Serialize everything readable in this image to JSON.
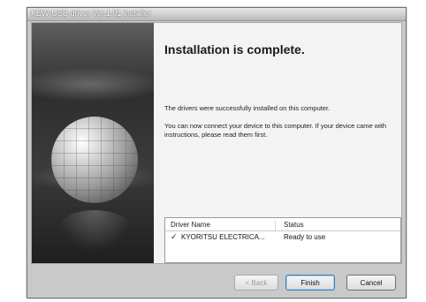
{
  "window": {
    "title": "KEW-USB driver Ver.1.01 installer"
  },
  "main": {
    "heading": "Installation is complete.",
    "message_success": "The drivers were successfully installed on this computer.",
    "message_connect": "You can now connect your device to this computer. If your device came with instructions, please read them first."
  },
  "driver_table": {
    "columns": [
      "Driver Name",
      "Status"
    ],
    "rows": [
      {
        "check": "✓",
        "name": "KYORITSU ELECTRICA...",
        "status": "Ready to use"
      }
    ]
  },
  "buttons": {
    "back": "< Back",
    "finish": "Finish",
    "cancel": "Cancel"
  },
  "icons": {
    "banner": "globe-banner-image",
    "row_check": "checkmark-icon"
  }
}
